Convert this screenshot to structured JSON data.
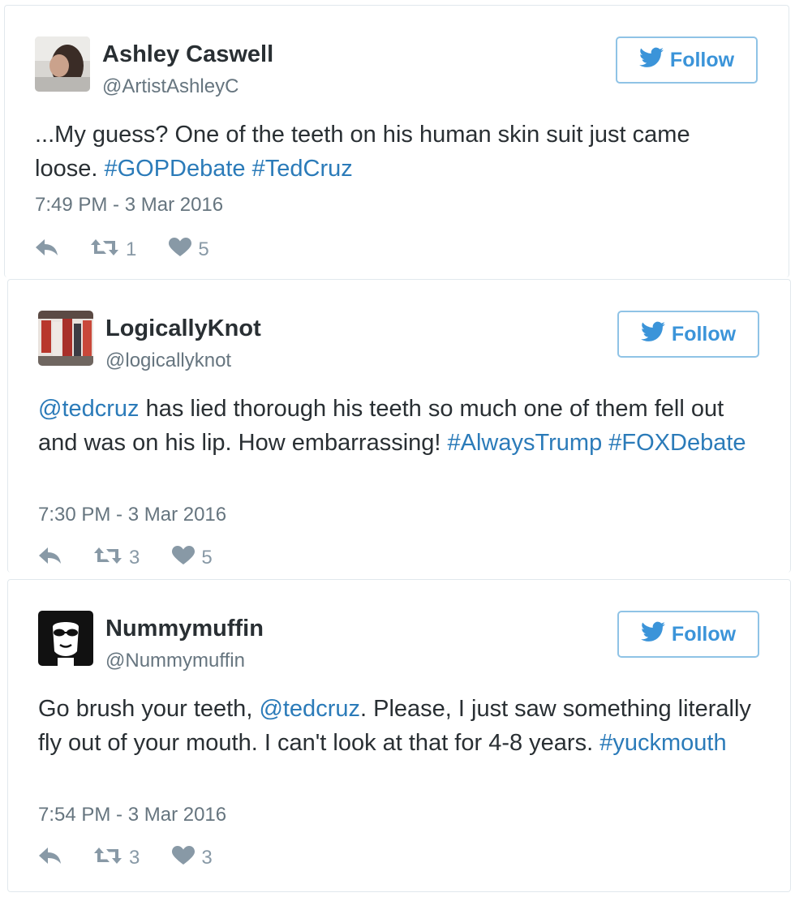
{
  "colors": {
    "link": "#2b7bb9",
    "follow_blue": "#3b94d9",
    "meta_gray": "#66757f",
    "icon_gray": "#8899a6"
  },
  "tweets": [
    {
      "name": "Ashley Caswell",
      "handle": "@ArtistAshleyC",
      "follow_label": "Follow",
      "text": [
        {
          "t": "...My guess? One of the teeth on his human skin suit just came loose. "
        },
        {
          "t": "#GOPDebate",
          "link": true
        },
        {
          "t": " "
        },
        {
          "t": "#TedCruz",
          "link": true
        }
      ],
      "time": "7:49 PM - 3 Mar 2016",
      "retweets": "1",
      "likes": "5",
      "icons": {
        "follow": "twitter-bird-icon",
        "reply": "reply-icon",
        "retweet": "retweet-icon",
        "like": "heart-icon"
      }
    },
    {
      "name": "LogicallyKnot",
      "handle": "@logicallyknot",
      "follow_label": "Follow",
      "text": [
        {
          "t": "@tedcruz",
          "link": true
        },
        {
          "t": " has lied thorough his teeth so much one of them fell out and was on his lip. How embarrassing! "
        },
        {
          "t": "#AlwaysTrump",
          "link": true
        },
        {
          "t": " "
        },
        {
          "t": "#FOXDebate",
          "link": true
        }
      ],
      "time": "7:30 PM - 3 Mar 2016",
      "retweets": "3",
      "likes": "5",
      "icons": {
        "follow": "twitter-bird-icon",
        "reply": "reply-icon",
        "retweet": "retweet-icon",
        "like": "heart-icon"
      }
    },
    {
      "name": "Nummymuffin",
      "handle": "@Nummymuffin",
      "follow_label": "Follow",
      "text": [
        {
          "t": "Go brush your teeth, "
        },
        {
          "t": "@tedcruz",
          "link": true
        },
        {
          "t": ". Please, I just saw something literally fly out of your mouth. I can't look at that for 4-8 years. "
        },
        {
          "t": "#yuckmouth",
          "link": true
        }
      ],
      "time": "7:54 PM - 3 Mar 2016",
      "retweets": "3",
      "likes": "3",
      "icons": {
        "follow": "twitter-bird-icon",
        "reply": "reply-icon",
        "retweet": "retweet-icon",
        "like": "heart-icon"
      }
    }
  ]
}
